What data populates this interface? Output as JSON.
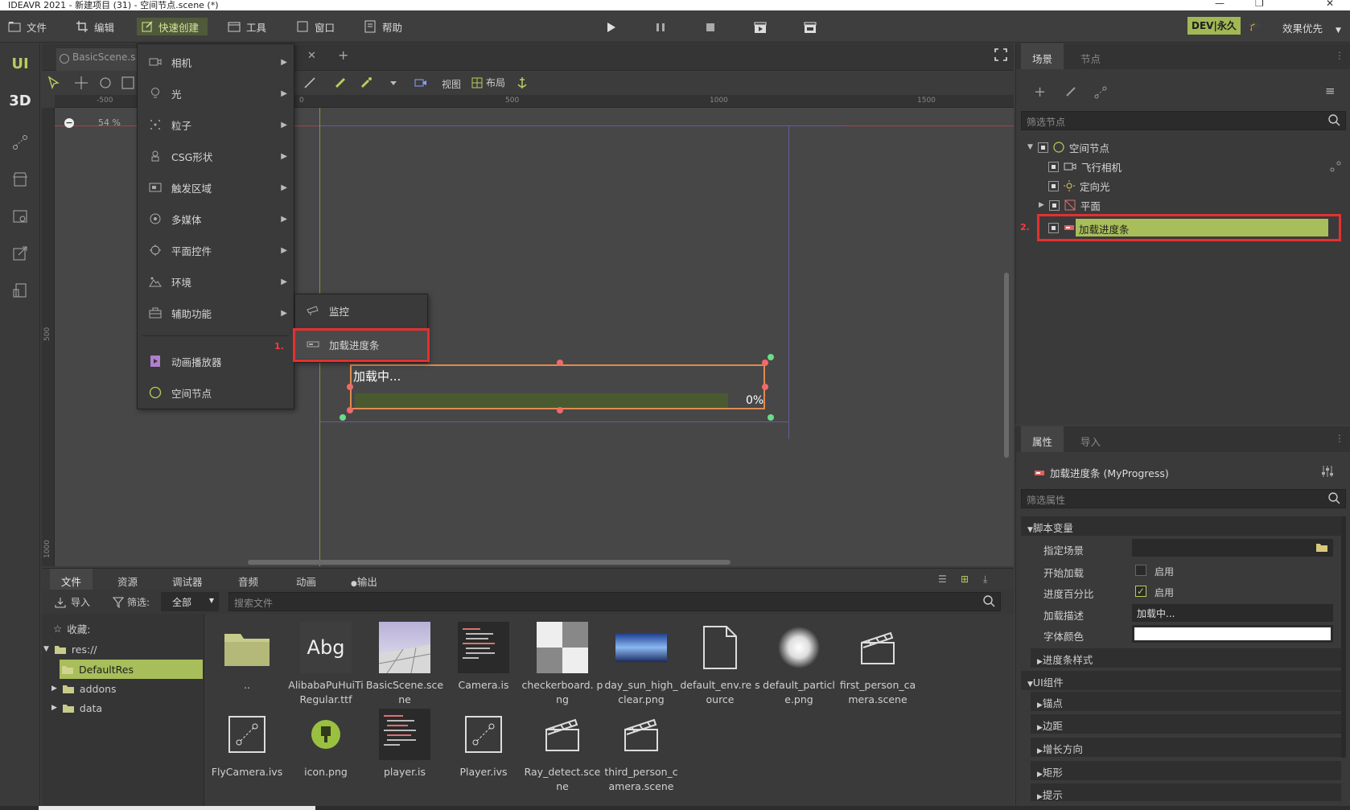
{
  "titlebar": {
    "title": "IDEAVR 2021 - 新建项目 (31) - 空间节点.scene (*)"
  },
  "menubar": {
    "items": [
      "文件",
      "编辑",
      "快速创建",
      "工具",
      "窗口",
      "帮助"
    ],
    "dev_badge": "DEV|永久",
    "effect": "效果优先"
  },
  "leftbar": {
    "ui": "UI",
    "three_d": "3D"
  },
  "editor": {
    "tab": "BasicScene.s",
    "toolbar": {
      "view": "视图",
      "layout": "布局"
    },
    "zoom": "54 %",
    "ruler_top": [
      "-500",
      "0",
      "500",
      "1000",
      "1500"
    ],
    "ruler_left": [
      "500",
      "1000"
    ],
    "progress_widget": {
      "text": "加载中...",
      "percent": "0%"
    }
  },
  "quick_menu": {
    "items": [
      "相机",
      "光",
      "粒子",
      "CSG形状",
      "触发区域",
      "多媒体",
      "平面控件",
      "环境",
      "辅助功能"
    ],
    "bottom_items": [
      "动画播放器",
      "空间节点"
    ],
    "submenu": [
      "监控",
      "加载进度条"
    ],
    "step1": "1."
  },
  "scene_panel": {
    "tabs": [
      "场景",
      "节点"
    ],
    "filter_placeholder": "筛选节点",
    "tree": [
      "空间节点",
      "飞行相机",
      "定向光",
      "平面",
      "加载进度条"
    ],
    "step2": "2."
  },
  "prop_panel": {
    "tabs": [
      "属性",
      "导入"
    ],
    "node_title": "加载进度条 (MyProgress)",
    "filter_placeholder": "筛选属性",
    "sections": [
      "脚本变量",
      "进度条样式",
      "UI组件",
      "锚点",
      "边距",
      "增长方向",
      "矩形",
      "提示"
    ],
    "rows": [
      {
        "label": "指定场景",
        "value": ""
      },
      {
        "label": "开始加载",
        "value": "启用"
      },
      {
        "label": "进度百分比",
        "value": "启用"
      },
      {
        "label": "加载描述",
        "value": "加载中..."
      },
      {
        "label": "字体颜色",
        "value": ""
      }
    ],
    "progress_checked": true,
    "start_checked": false
  },
  "bottom_panel": {
    "tabs": [
      "文件",
      "资源",
      "调试器",
      "音频",
      "动画",
      "输出"
    ],
    "import": "导入",
    "filter_label": "筛选:",
    "filter_value": "全部",
    "search_placeholder": "搜索文件",
    "favorites": "收藏:",
    "tree": [
      "res://",
      "DefaultRes",
      "addons",
      "data"
    ],
    "files_row1": [
      {
        "name": "..",
        "icon": "folder-icon"
      },
      {
        "name": "AlibabaPuHuiTi Regular.ttf",
        "icon": "font-icon",
        "thumb_text": "Abg"
      },
      {
        "name": "BasicScene.sce ne",
        "icon": "scene-thumb"
      },
      {
        "name": "Camera.is",
        "icon": "script-thumb"
      },
      {
        "name": "checkerboard. png",
        "icon": "checker-thumb"
      },
      {
        "name": "day_sun_high_ clear.png",
        "icon": "sky-thumb"
      },
      {
        "name": "default_env.re source",
        "icon": "doc-icon"
      },
      {
        "name": "default_particl e.png",
        "icon": "particle-thumb"
      },
      {
        "name": "first_person_ca mera.scene",
        "icon": "clapper-icon"
      }
    ],
    "files_row2": [
      {
        "name": "FlyCamera.ivs",
        "icon": "ivs-icon"
      },
      {
        "name": "icon.png",
        "icon": "app-icon"
      },
      {
        "name": "player.is",
        "icon": "script-thumb"
      },
      {
        "name": "Player.ivs",
        "icon": "ivs-icon"
      },
      {
        "name": "Ray_detect.sce ne",
        "icon": "clapper-icon"
      },
      {
        "name": "third_person_c amera.scene",
        "icon": "clapper-icon"
      }
    ]
  },
  "colors": {
    "accent": "#a8be5a",
    "highlight": "#e53030",
    "bg": "#3c3c3c"
  }
}
